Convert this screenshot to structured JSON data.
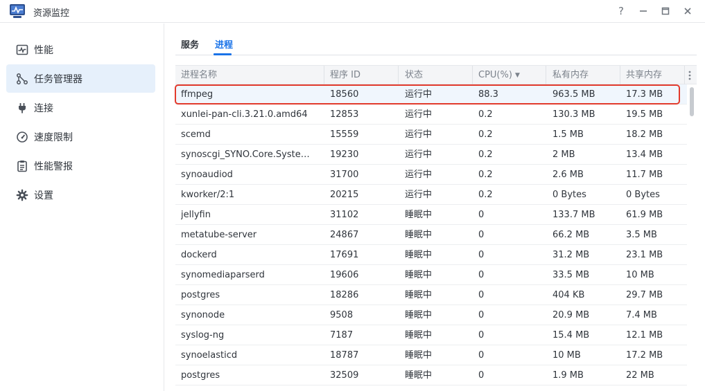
{
  "window": {
    "title": "资源监控",
    "help_label": "?"
  },
  "sidebar": {
    "items": [
      {
        "label": "性能",
        "icon": "performance-chart-icon"
      },
      {
        "label": "任务管理器",
        "icon": "task-manager-icon",
        "active": true
      },
      {
        "label": "连接",
        "icon": "plug-icon"
      },
      {
        "label": "速度限制",
        "icon": "speedometer-icon"
      },
      {
        "label": "性能警报",
        "icon": "clipboard-alert-icon"
      },
      {
        "label": "设置",
        "icon": "gear-icon"
      }
    ]
  },
  "tabs": [
    {
      "label": "服务"
    },
    {
      "label": "进程",
      "active": true
    }
  ],
  "table": {
    "columns": [
      "进程名称",
      "程序 ID",
      "状态",
      "CPU(%)",
      "私有内存",
      "共享内存"
    ],
    "sort_column": "CPU(%)",
    "sort_direction": "desc",
    "rows": [
      [
        "ffmpeg",
        "18560",
        "运行中",
        "88.3",
        "963.5 MB",
        "17.3 MB"
      ],
      [
        "xunlei-pan-cli.3.21.0.amd64",
        "12853",
        "运行中",
        "0.2",
        "130.3 MB",
        "19.5 MB"
      ],
      [
        "scemd",
        "15559",
        "运行中",
        "0.2",
        "1.5 MB",
        "18.2 MB"
      ],
      [
        "synoscgi_SYNO.Core.Syste…",
        "19230",
        "运行中",
        "0.2",
        "2 MB",
        "13.4 MB"
      ],
      [
        "synoaudiod",
        "31700",
        "运行中",
        "0.2",
        "2.6 MB",
        "11.7 MB"
      ],
      [
        "kworker/2:1",
        "20215",
        "运行中",
        "0.2",
        "0 Bytes",
        "0 Bytes"
      ],
      [
        "jellyfin",
        "31102",
        "睡眠中",
        "0",
        "133.7 MB",
        "61.9 MB"
      ],
      [
        "metatube-server",
        "24867",
        "睡眠中",
        "0",
        "66.2 MB",
        "3.5 MB"
      ],
      [
        "dockerd",
        "17691",
        "睡眠中",
        "0",
        "31.2 MB",
        "23.1 MB"
      ],
      [
        "synomediaparserd",
        "19606",
        "睡眠中",
        "0",
        "33.5 MB",
        "10 MB"
      ],
      [
        "postgres",
        "18286",
        "睡眠中",
        "0",
        "404 KB",
        "29.7 MB"
      ],
      [
        "synonode",
        "9508",
        "睡眠中",
        "0",
        "20.9 MB",
        "7.4 MB"
      ],
      [
        "syslog-ng",
        "7187",
        "睡眠中",
        "0",
        "15.4 MB",
        "12.1 MB"
      ],
      [
        "synoelasticd",
        "18787",
        "睡眠中",
        "0",
        "10 MB",
        "17.2 MB"
      ],
      [
        "postgres",
        "32509",
        "睡眠中",
        "0",
        "1.9 MB",
        "22 MB"
      ]
    ]
  },
  "colors": {
    "accent": "#1a73e8",
    "active_nav_bg": "#e6f0fb",
    "highlight_border": "#e23a2c"
  }
}
